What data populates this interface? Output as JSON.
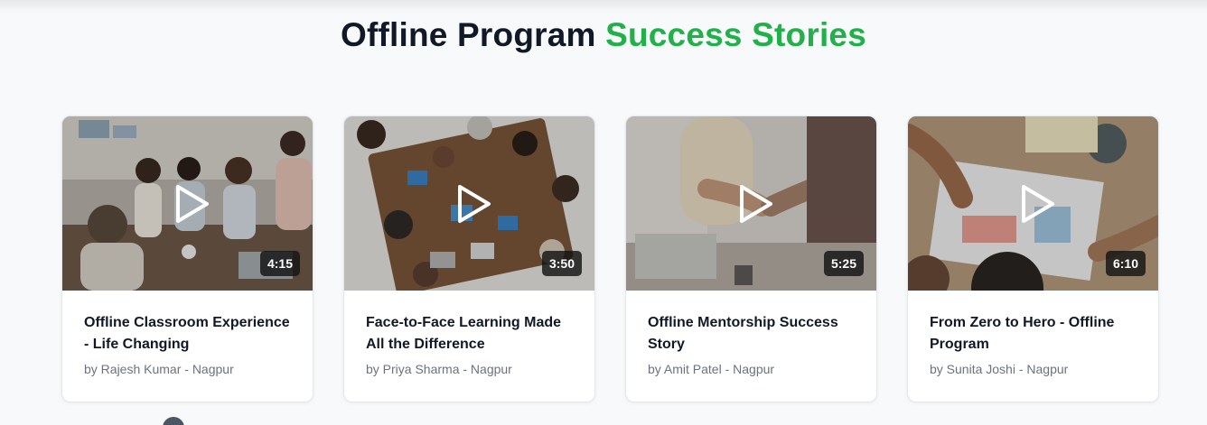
{
  "section": {
    "title_main": "Offline Program",
    "title_accent": "Success Stories"
  },
  "colors": {
    "accent": "#22b04b",
    "heading": "#111827",
    "muted": "#6b7280"
  },
  "cards": [
    {
      "title": "Offline Classroom Experience - Life Changing",
      "author": "by Rajesh Kumar - Nagpur",
      "duration": "4:15",
      "thumbnail_icon": "play-icon"
    },
    {
      "title": "Face-to-Face Learning Made All the Difference",
      "author": "by Priya Sharma - Nagpur",
      "duration": "3:50",
      "thumbnail_icon": "play-icon"
    },
    {
      "title": "Offline Mentorship Success Story",
      "author": "by Amit Patel - Nagpur",
      "duration": "5:25",
      "thumbnail_icon": "play-icon"
    },
    {
      "title": "From Zero to Hero - Offline Program",
      "author": "by Sunita Joshi - Nagpur",
      "duration": "6:10",
      "thumbnail_icon": "play-icon"
    }
  ]
}
